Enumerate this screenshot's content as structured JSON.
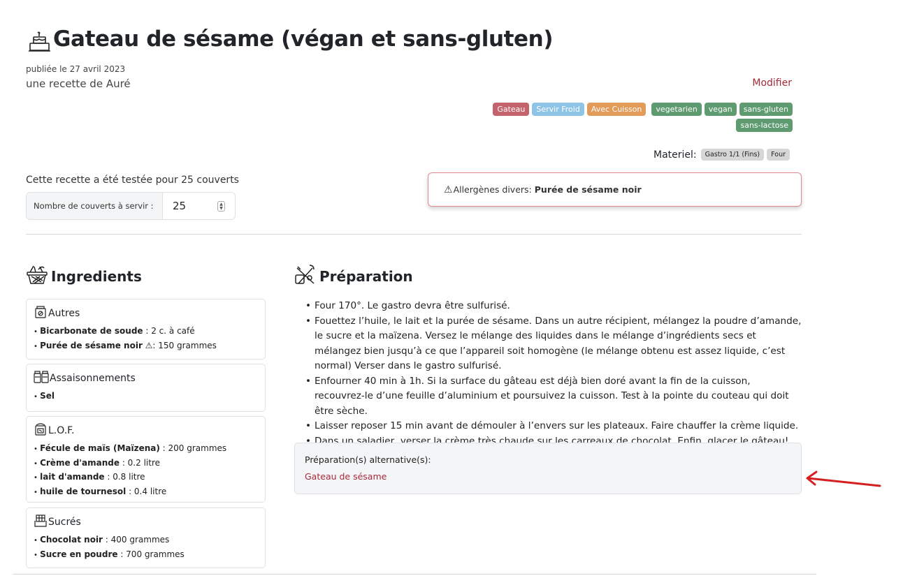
{
  "recipe": {
    "title": "Gateau de sésame (végan et sans-gluten)",
    "published": "publiée le 27 avril 2023",
    "author": "une recette de Auré",
    "edit_label": "Modifier"
  },
  "tags": [
    {
      "label": "Gateau",
      "color": "#c5636c"
    },
    {
      "label": "Servir Froid",
      "color": "#8ec4e6"
    },
    {
      "label": "Avec Cuisson",
      "color": "#e39b5a"
    },
    {
      "label": "vegetarien",
      "color": "#5e9b70"
    },
    {
      "label": "vegan",
      "color": "#5e9b70"
    },
    {
      "label": "sans-gluten",
      "color": "#5e9b70"
    },
    {
      "label": "sans-lactose",
      "color": "#5e9b70"
    }
  ],
  "materiel": {
    "label": "Materiel:",
    "items": [
      "Gastro 1/1 (Fins)",
      "Four"
    ]
  },
  "servings": {
    "tested_text": "Cette recette a été testée pour 25 couverts",
    "input_label": "Nombre de couverts à servir :",
    "value": "25"
  },
  "allergen": {
    "icon": "warning-icon",
    "label": "Allergènes divers:",
    "value": "Purée de sésame noir"
  },
  "ingredients": {
    "heading": "Ingredients",
    "groups": [
      {
        "name": "Autres",
        "items": [
          {
            "name": "Bicarbonate de soude",
            "qty": " : 2 c. à café"
          },
          {
            "name": "Purée de sésame noir",
            "qty": " ⚠: 150 grammes"
          }
        ]
      },
      {
        "name": "Assaisonnements",
        "items": [
          {
            "name": "Sel",
            "qty": ""
          }
        ]
      },
      {
        "name": "L.O.F.",
        "items": [
          {
            "name": "Fécule de maïs (Maïzena)",
            "qty": " : 200 grammes"
          },
          {
            "name": "Crème d'amande",
            "qty": " : 0.2 litre"
          },
          {
            "name": "lait d'amande",
            "qty": " : 0.8 litre"
          },
          {
            "name": "huile de tournesol",
            "qty": " : 0.4 litre"
          }
        ]
      },
      {
        "name": "Sucrés",
        "items": [
          {
            "name": "Chocolat noir",
            "qty": " : 400 grammes"
          },
          {
            "name": "Sucre en poudre",
            "qty": " : 700 grammes"
          }
        ]
      }
    ]
  },
  "preparation": {
    "heading": "Préparation",
    "steps": [
      "Four 170°. Le gastro devra être sulfurisé.",
      "Fouettez l’huile, le lait et la purée de sésame. Dans un autre récipient, mélangez la poudre d’amande, le sucre et la maïzena. Versez le mélange des liquides dans le mélange d’ingrédients secs et mélangez bien jusqu’à ce que l’appareil soit homogène (le mélange obtenu est assez liquide, c’est normal) Verser dans le gastro sulfurisé.",
      "Enfourner 40 min à 1h. Si la surface du gâteau est déjà bien doré avant la fin de la cuisson, recouvrez-le d’une feuille d’aluminium et poursuivez la cuisson. Test à la pointe du couteau qui doit être sèche.",
      "Laisser reposer 15 min avant de démouler à l’envers sur les plateaux. Faire chauffer la crème liquide.",
      "Dans un saladier, verser la crème très chaude sur les carreaux de chocolat. Enfin, glacer le gâteau!"
    ],
    "alternatives_label": "Préparation(s) alternative(s):",
    "alternatives": [
      "Gateau de sésame"
    ]
  },
  "colors": {
    "link": "#a52a3a",
    "annotation_arrow": "#d42020"
  }
}
